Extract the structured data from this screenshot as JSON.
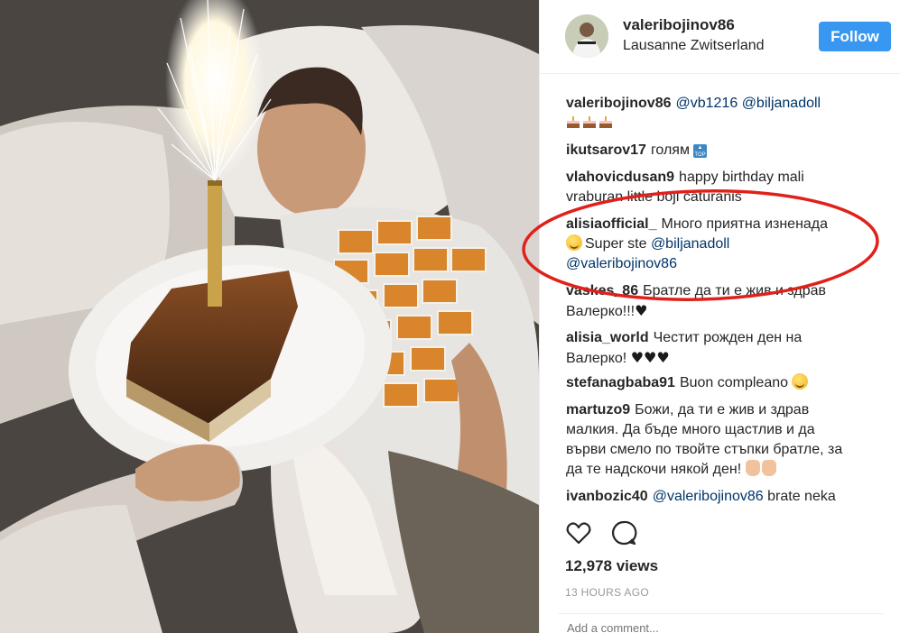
{
  "post": {
    "username": "valeribojinov86",
    "location": "Lausanne Zwitserland",
    "follow_label": "Follow"
  },
  "comments": [
    {
      "user": "valeribojinov86",
      "parts": [
        "@vb1216",
        "@biljanadoll"
      ],
      "emoji": "cake-emoji x3"
    },
    {
      "user": "ikutsarov17",
      "text": "голям",
      "emoji": "top-emoji"
    },
    {
      "user": "vlahovicdusan9",
      "text_line1": "happy birthday mali",
      "text_line2": "vraburan little boji caturanis"
    },
    {
      "user": "alisiaofficial_",
      "text_line1": "Много приятна изненада",
      "text_line2": "Super ste",
      "mention1": "@biljanadoll",
      "mention2": "@valeribojinov86",
      "emoji": "smile-emoji"
    },
    {
      "user": "vaskes_86",
      "text_line1": "Братле да ти е жив и здрав",
      "text_line2": "Валерко!!!",
      "emoji": "black-heart"
    },
    {
      "user": "alisia_world",
      "text_line1": "Честит рожден ден на",
      "text_line2": "Валерко!",
      "emoji": "black-heart x3"
    },
    {
      "user": "stefanagbaba91",
      "text": "Buon compleano",
      "emoji": "smile-emoji"
    },
    {
      "user": "martuzo9",
      "text_line1": "Божи, да ти е жив и здрав",
      "text_line2": "малкия. Да бъде много щастлив и да",
      "text_line3": "върви смело по твойте стъпки братле, за",
      "text_line4": "да те надскочи някой ден!",
      "emoji": "rock-hand, fist"
    },
    {
      "user": "ivanbozic40",
      "mention": "@valeribojinov86",
      "text": "brate neka"
    }
  ],
  "stats": {
    "views": "12,978 views",
    "time_ago": "13 HOURS AGO",
    "add_comment_placeholder": "Add a comment..."
  },
  "icons": {
    "like": "heart-outline-icon",
    "comment": "speech-bubble-icon"
  },
  "colors": {
    "follow_button": "#3897f0",
    "mention": "#003569",
    "annotation": "#e0211b"
  }
}
